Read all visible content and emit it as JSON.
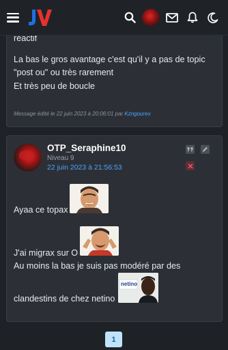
{
  "header": {
    "logo_text": "JV",
    "brand_colors": {
      "j": "#1f6fe0",
      "v": "#e5322d"
    },
    "icons": [
      "menu-icon",
      "search-icon",
      "user-avatar",
      "mail-icon",
      "bell-icon",
      "dark-mode-icon"
    ]
  },
  "previous_post": {
    "lines": [
      "réactif",
      "La bas le gros avantage c'est qu'il y a pas de topic",
      "\"post ou\" ou très rarement",
      "Et très peu de boucle"
    ],
    "edited_prefix": "Message édité le 22 juin 2023 à 20:06:01 par",
    "edited_author": "Kzngourex"
  },
  "post": {
    "username": "OTP_Seraphine10",
    "level": "Niveau 9",
    "date": "22 juin 2023 à 21:56:53",
    "lines": [
      "Ayaa ce topax",
      "J'ai migrax sur O",
      "Au moins la bas je suis pas modéré par des",
      "clandestins de chez netino"
    ],
    "sticker_text": "netino"
  },
  "pagination": {
    "current_page": "1"
  }
}
